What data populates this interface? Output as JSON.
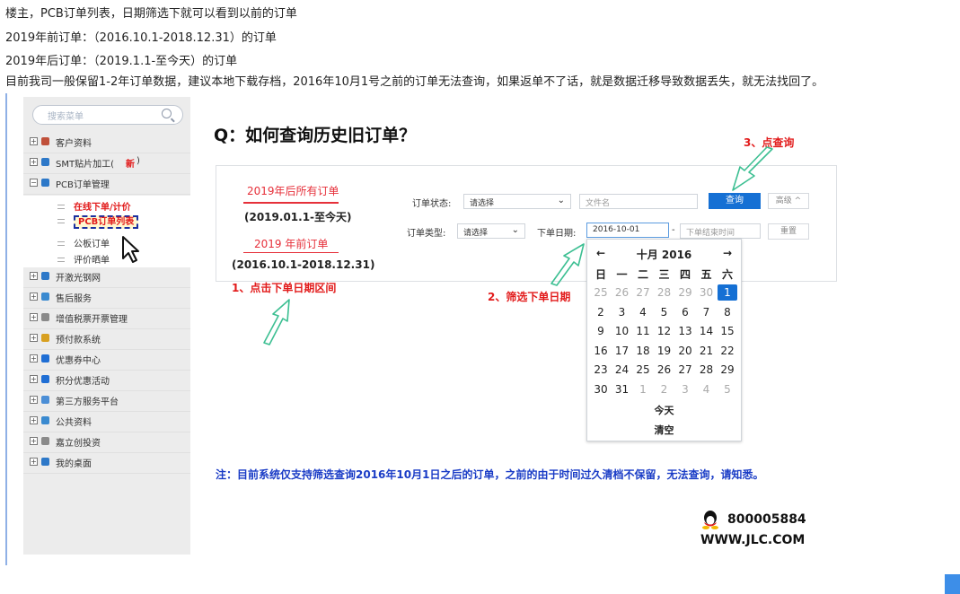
{
  "intro_lines": [
    "楼主，PCB订单列表，日期筛选下就可以看到以前的订单",
    "2019年前订单：（2016.10.1-2018.12.31）的订单",
    "2019年后订单：（2019.1.1-至今天）的订单",
    "目前我司一般保留1-2年订单数据，建议本地下载存档，2016年10月1号之前的订单无法查询，如果返单不了话，就是数据迁移导致数据丢失，就无法找回了。"
  ],
  "sidebar": {
    "search_placeholder": "搜索菜单",
    "items": [
      {
        "label": "客户资料",
        "color": "#c0503a"
      },
      {
        "label": "SMT贴片加工(",
        "hot": "新",
        "tail": ")",
        "color": "#2d78c8"
      },
      {
        "label": "PCB订单管理",
        "color": "#2d78c8",
        "expanded": true
      },
      {
        "label": "开激光钢网",
        "color": "#2d78c8"
      },
      {
        "label": "售后服务",
        "color": "#3a8ad0"
      },
      {
        "label": "增值税票开票管理",
        "color": "#8a8a8a"
      },
      {
        "label": "预付款系统",
        "color": "#d8a020"
      },
      {
        "label": "优惠券中心",
        "color": "#1f6ed4"
      },
      {
        "label": "积分优惠活动",
        "color": "#1f6ed4"
      },
      {
        "label": "第三方服务平台",
        "color": "#4b8ed6"
      },
      {
        "label": "公共资料",
        "color": "#3a8ad0"
      },
      {
        "label": "嘉立创投资",
        "color": "#8a8a8a"
      },
      {
        "label": "我的桌面",
        "color": "#2d78c8"
      }
    ],
    "sub_items": [
      "在线下单/计价",
      "PCB订单列表",
      "公板订单",
      "评价晒单"
    ]
  },
  "main": {
    "title": "Q：如何查询历史旧订单？",
    "left": {
      "link1": "2019年后所有订单",
      "range1": "(2019.01.1-至今天)",
      "link2": "2019 年前订单",
      "range2": "(2016.10.1-2018.12.31)"
    },
    "filters": {
      "status_label": "订单状态:",
      "status_value": "请选择",
      "filename_placeholder": "文件名",
      "search_button": "查询",
      "advanced": "高级 ^",
      "type_label": "订单类型:",
      "type_value": "请选择",
      "date_label": "下单日期:",
      "date_value": "2016-10-01",
      "dash": "-",
      "end_placeholder": "下单结束时间",
      "reset": "重置"
    },
    "annotations": {
      "step1": "1、点击下单日期区间",
      "step2": "2、筛选下单日期",
      "step3": "3、点查询"
    },
    "calendar": {
      "prev": "←",
      "next": "→",
      "month": "十月 2016",
      "weekdays": [
        "日",
        "一",
        "二",
        "三",
        "四",
        "五",
        "六"
      ],
      "weeks": [
        [
          "25",
          "26",
          "27",
          "28",
          "29",
          "30",
          "1"
        ],
        [
          "2",
          "3",
          "4",
          "5",
          "6",
          "7",
          "8"
        ],
        [
          "9",
          "10",
          "11",
          "12",
          "13",
          "14",
          "15"
        ],
        [
          "16",
          "17",
          "18",
          "19",
          "20",
          "21",
          "22"
        ],
        [
          "23",
          "24",
          "25",
          "26",
          "27",
          "28",
          "29"
        ],
        [
          "30",
          "31",
          "1",
          "2",
          "3",
          "4",
          "5"
        ]
      ],
      "today": "今天",
      "clear": "清空"
    },
    "note": "注：目前系统仅支持筛选查询2016年10月1日之后的订单，之前的由于时间过久清档不保留，无法查询，请知悉。",
    "contact_qq": "800005884",
    "contact_url": "WWW.JLC.COM"
  }
}
